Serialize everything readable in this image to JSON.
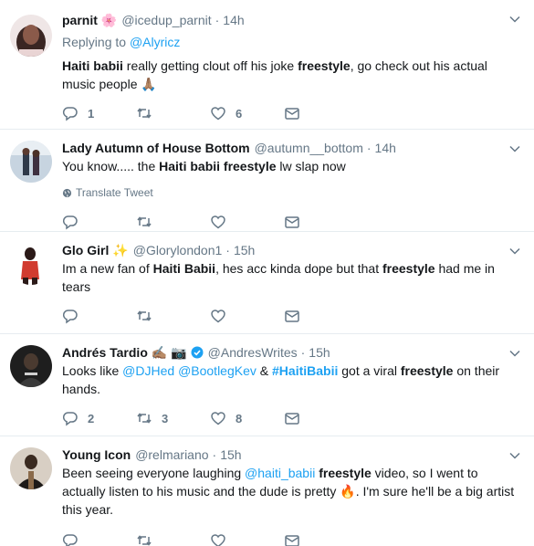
{
  "tweets": [
    {
      "name": "parnit",
      "name_emoji": "🌸",
      "handle": "@icedup_parnit",
      "time": "14h",
      "replying_prefix": "Replying to ",
      "replying_to": "@Alyricz",
      "body": [
        {
          "b": "Haiti babii"
        },
        {
          "t": " really getting clout off his joke "
        },
        {
          "b": "freestyle"
        },
        {
          "t": ", go check out his actual music people 🙏🏽"
        }
      ],
      "counts": {
        "reply": "1",
        "retweet": "",
        "like": "6"
      },
      "avatar_color": "#5a3f3a"
    },
    {
      "name": "Lady Autumn of House Bottom",
      "handle": "@autumn__bottom",
      "time": "14h",
      "body": [
        {
          "t": "You know..... the "
        },
        {
          "b": "Haiti babii freestyle"
        },
        {
          "t": " lw slap now"
        }
      ],
      "translate": "Translate Tweet",
      "counts": {
        "reply": "",
        "retweet": "",
        "like": ""
      },
      "avatar_color": "#8aa0b4"
    },
    {
      "name": "Glo Girl",
      "name_emoji": "✨",
      "handle": "@Glorylondon1",
      "time": "15h",
      "body": [
        {
          "t": "Im a new fan of "
        },
        {
          "b": "Haiti Babii"
        },
        {
          "t": ", hes acc kinda dope but that "
        },
        {
          "b": "freestyle"
        },
        {
          "t": " had me in tears"
        }
      ],
      "counts": {
        "reply": "",
        "retweet": "",
        "like": ""
      },
      "avatar_color": "#c94c3f"
    },
    {
      "name": "Andrés Tardio",
      "name_emoji": "✍🏽 📷",
      "handle": "@AndresWrites",
      "time": "15h",
      "verified": true,
      "body": [
        {
          "t": "Looks like "
        },
        {
          "l": "@DJHed"
        },
        {
          "t": " "
        },
        {
          "l": "@BootlegKev"
        },
        {
          "t": " & "
        },
        {
          "lb": "#HaitiBabii"
        },
        {
          "t": " got a viral "
        },
        {
          "b": "freestyle"
        },
        {
          "t": " on their hands."
        }
      ],
      "counts": {
        "reply": "2",
        "retweet": "3",
        "like": "8"
      },
      "avatar_color": "#2a2a2a"
    },
    {
      "name": "Young Icon",
      "handle": "@relmariano",
      "time": "15h",
      "body": [
        {
          "t": "Been seeing everyone laughing "
        },
        {
          "l": "@haiti_babii"
        },
        {
          "t": " "
        },
        {
          "b": "freestyle"
        },
        {
          "t": " video, so I went to actually listen to his music and the dude is pretty 🔥. I'm sure he'll be a big artist this year."
        }
      ],
      "counts": {
        "reply": "",
        "retweet": "",
        "like": ""
      },
      "avatar_color": "#6b5a4a"
    }
  ],
  "icons": {
    "reply": "reply-icon",
    "retweet": "retweet-icon",
    "like": "like-icon",
    "dm": "direct-message-icon",
    "more": "chevron-down-icon",
    "globe": "globe-icon",
    "verified": "verified-badge-icon"
  },
  "colors": {
    "link": "#1da1f2",
    "muted": "#657786",
    "divider": "#e6ecf0",
    "text": "#14171a"
  }
}
